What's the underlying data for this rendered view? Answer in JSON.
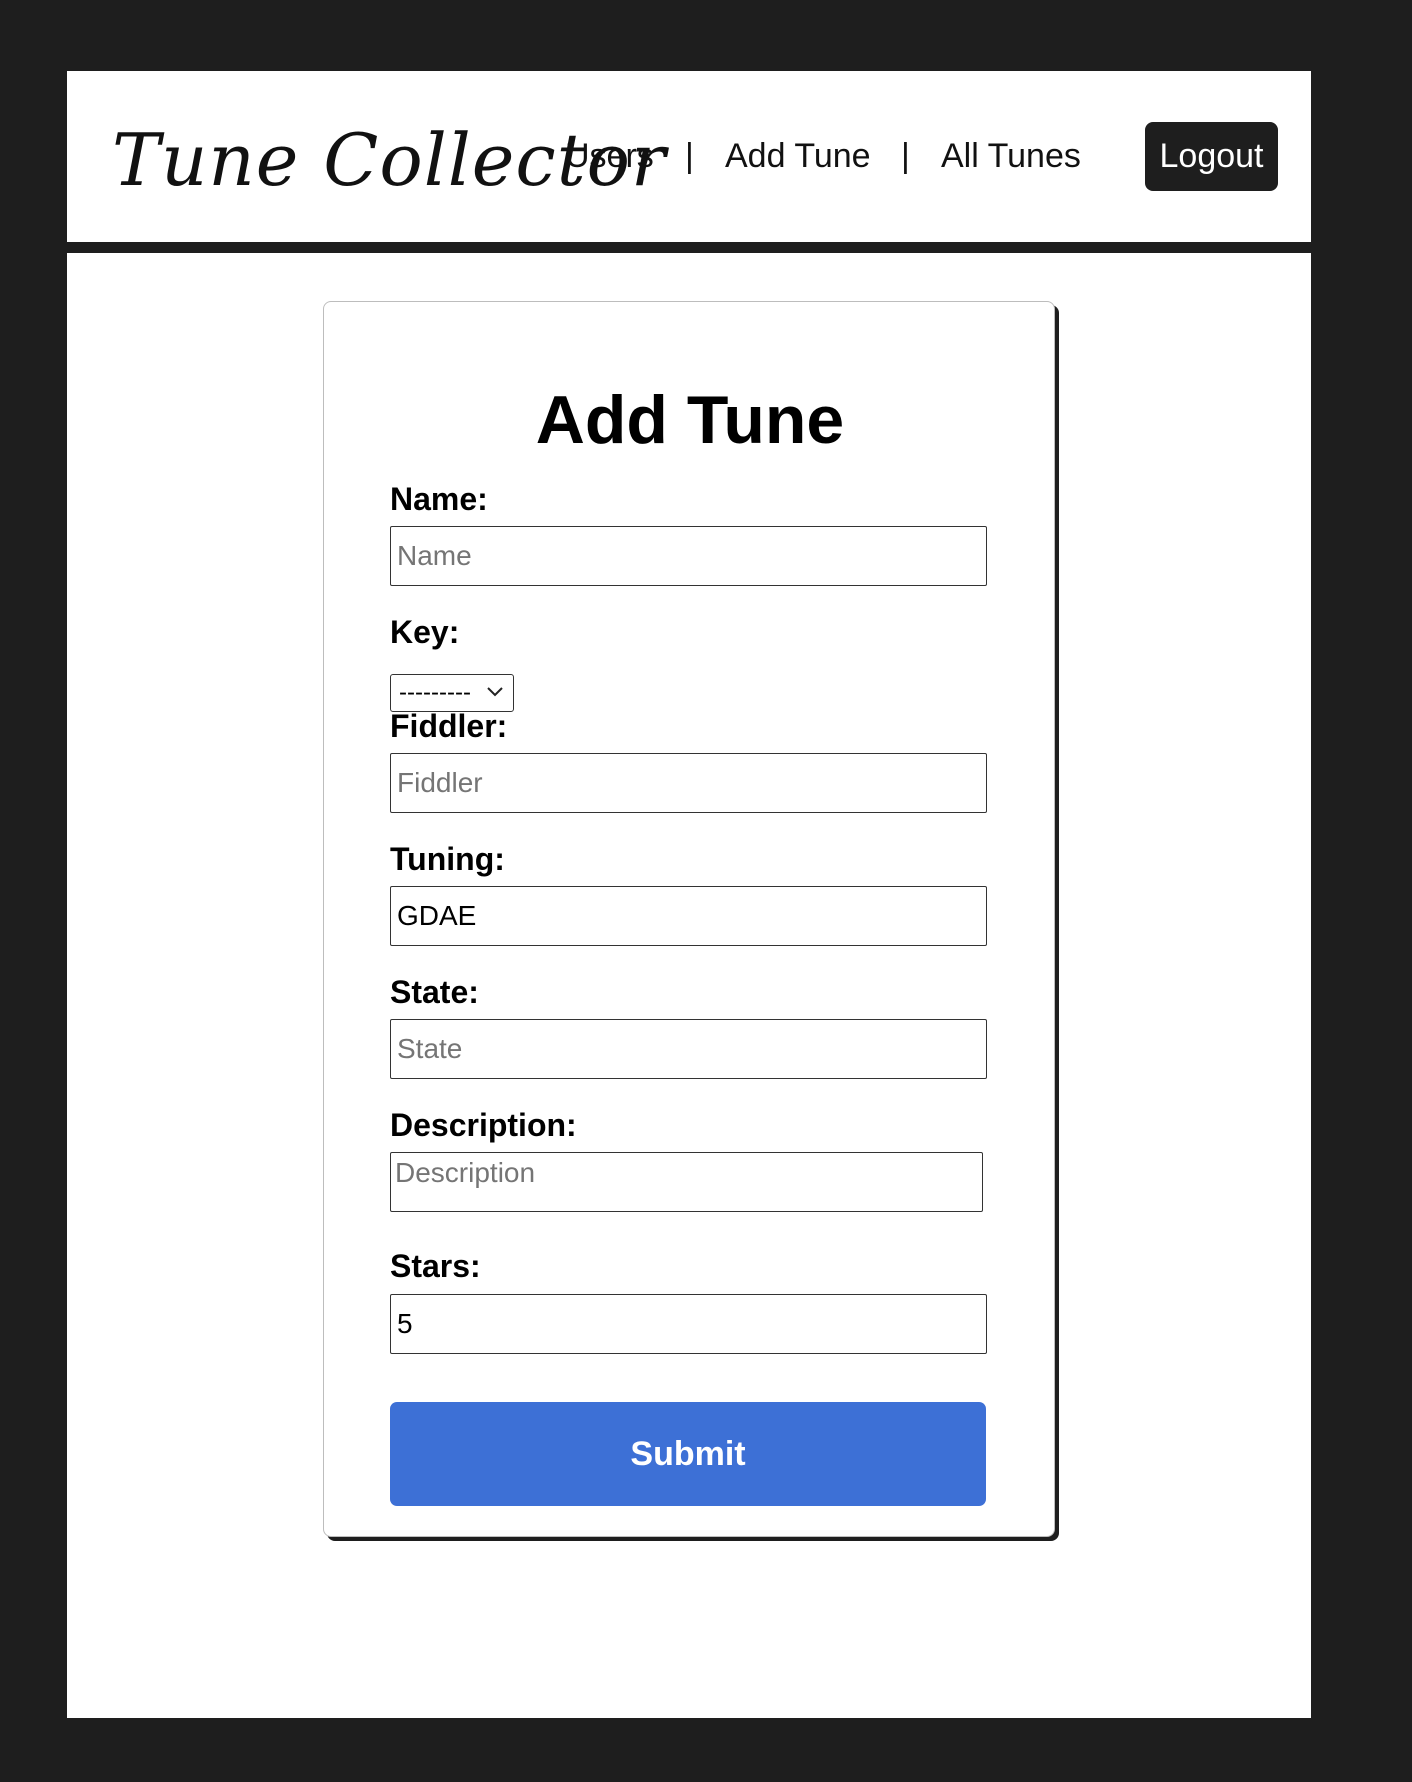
{
  "nav": {
    "brand": "Tune Collector",
    "links": [
      {
        "label": "Users"
      },
      {
        "label": "Add Tune"
      },
      {
        "label": "All Tunes"
      }
    ],
    "separator": "|",
    "logout_label": "Logout"
  },
  "form": {
    "title": "Add Tune",
    "name": {
      "label": "Name:",
      "placeholder": "Name",
      "value": ""
    },
    "key": {
      "label": "Key:",
      "selected": "---------"
    },
    "fiddler": {
      "label": "Fiddler:",
      "placeholder": "Fiddler",
      "value": ""
    },
    "tuning": {
      "label": "Tuning:",
      "value": "GDAE"
    },
    "state": {
      "label": "State:",
      "placeholder": "State",
      "value": ""
    },
    "description": {
      "label": "Description:",
      "placeholder": "Description",
      "value": ""
    },
    "stars": {
      "label": "Stars:",
      "value": "5"
    },
    "submit_label": "Submit"
  },
  "colors": {
    "background": "#1e1e1e",
    "submit": "#3d70d6",
    "logout": "#1e1e1e"
  }
}
